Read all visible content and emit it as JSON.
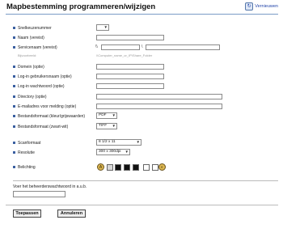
{
  "page": {
    "title": "Mapbestemming programmeren/wijzigen",
    "refresh_label": "Vernieuwen"
  },
  "form": {
    "fields": [
      {
        "label": "Snelkeuzenummer"
      },
      {
        "label": "Naam (vereist)"
      },
      {
        "label": "Servicenaam (vereist)"
      },
      {
        "label": "Domein (optie)"
      },
      {
        "label": "Log-in gebruikersnaam (optie)"
      },
      {
        "label": "Log-in wachtwoord (optie)"
      },
      {
        "label": "Directory (optie)"
      },
      {
        "label": "E-mailadres voor melding (optie)"
      },
      {
        "label": "Bestandsformaat (kleur/grijswaarden)"
      },
      {
        "label": "Bestandsformaat (zwart-wit)"
      },
      {
        "label": "Scanformaat"
      },
      {
        "label": "Resolutie"
      },
      {
        "label": "Belichting"
      }
    ],
    "service_prefix": "\\\\",
    "service_separator": "\\",
    "service_example_label": "Bijvoorbeeld:",
    "service_example": "\\\\Computer_name_or_IP\\Share_Folder",
    "file_format_color_value": "PDF",
    "file_format_bw_value": "TIFF",
    "scan_size_value": "8 1/2 x 11",
    "resolution_value": "300 x 300dpi",
    "password_prompt": "Voer het beheerderswachtwoord in a.u.b.",
    "apply_label": "Toepassen",
    "cancel_label": "Annuleren"
  }
}
